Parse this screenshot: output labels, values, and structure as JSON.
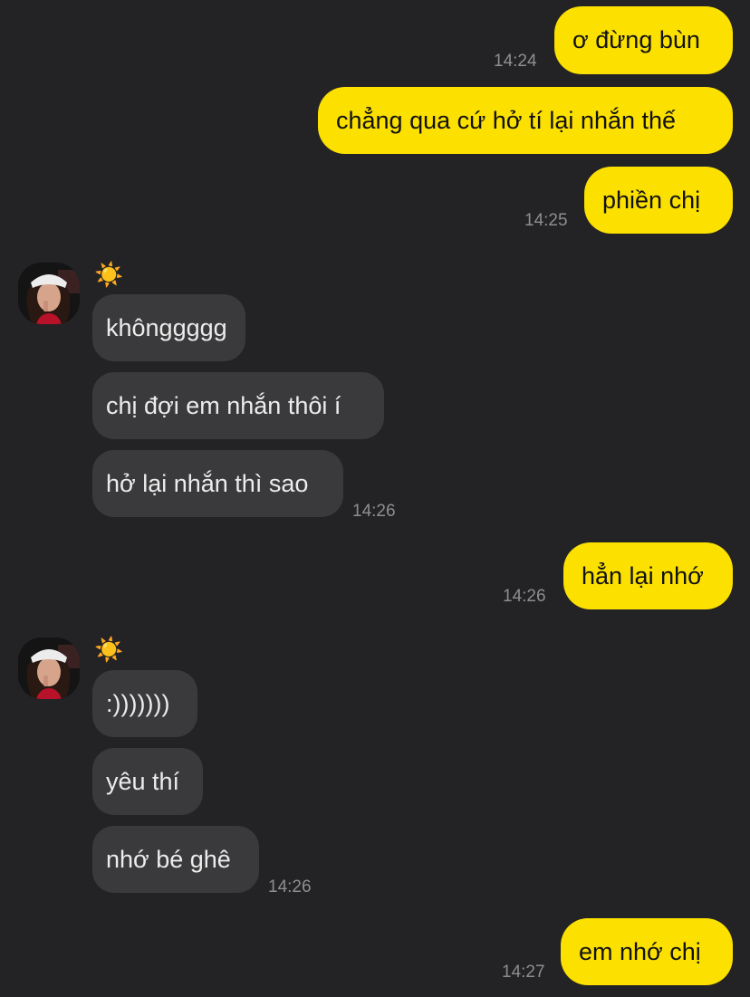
{
  "conversation": {
    "sent_1": {
      "text": "ơ đừng bùn",
      "time": "14:24"
    },
    "sent_2": {
      "text": "chẳng qua cứ hở tí lại nhắn thế"
    },
    "sent_3": {
      "text": "phiền chị",
      "time": "14:25"
    },
    "received_1": {
      "sender": "☀️",
      "messages": [
        "khônggggg",
        "chị đợi em nhắn thôi í",
        "hở lại nhắn thì sao"
      ],
      "time": "14:26"
    },
    "sent_4": {
      "text": "hẳn lại nhớ",
      "time": "14:26"
    },
    "received_2": {
      "sender": "☀️",
      "messages": [
        ":)))))))",
        "yêu thí",
        "nhớ bé ghê"
      ],
      "time": "14:26"
    },
    "sent_5": {
      "text": "em nhớ chị",
      "time": "14:27"
    }
  },
  "colors": {
    "background": "#232325",
    "outgoing_bubble": "#fbe000",
    "incoming_bubble": "#3a3a3c",
    "timestamp": "#8e8e92"
  }
}
